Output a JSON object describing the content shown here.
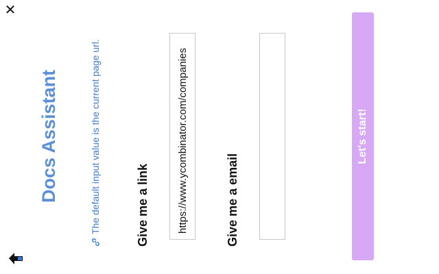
{
  "window": {
    "close_icon": "close-icon",
    "home_icon": "home-icon"
  },
  "header": {
    "title": "Docs Assistant",
    "hint": "The default input value is the current page url.",
    "hint_icon": "link-icon"
  },
  "form": {
    "link_label": "Give me a link",
    "link_value": "https://www.ycombinator.com/companies",
    "email_label": "Give me a email",
    "email_value": "",
    "submit_label": "Let's start!"
  },
  "colors": {
    "title": "#5b8fd8",
    "hint": "#3d7cd6",
    "button": "#d6a8f5"
  }
}
